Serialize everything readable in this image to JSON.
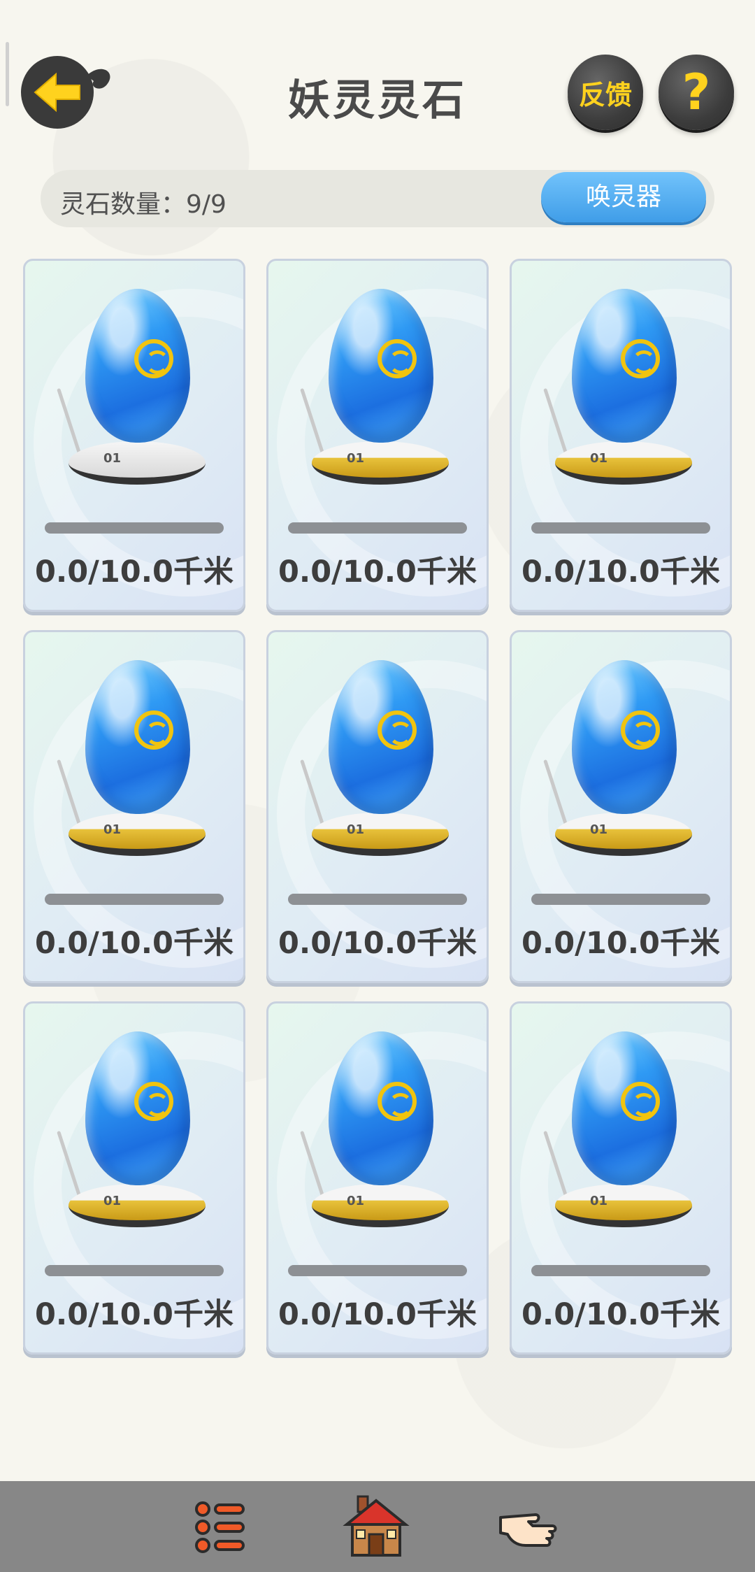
{
  "header": {
    "title": "妖灵灵石",
    "feedback_label": "反馈",
    "help_label": "?"
  },
  "count": {
    "label": "灵石数量：9/9",
    "summon_label": "唤灵器"
  },
  "stones": [
    {
      "progress": 0.0,
      "distance": "0.0/10.0千米",
      "base_label": "01",
      "base_color": "silver"
    },
    {
      "progress": 0.0,
      "distance": "0.0/10.0千米",
      "base_label": "01",
      "base_color": "gold"
    },
    {
      "progress": 0.0,
      "distance": "0.0/10.0千米",
      "base_label": "01",
      "base_color": "gold"
    },
    {
      "progress": 0.0,
      "distance": "0.0/10.0千米",
      "base_label": "01",
      "base_color": "gold"
    },
    {
      "progress": 0.0,
      "distance": "0.0/10.0千米",
      "base_label": "01",
      "base_color": "gold"
    },
    {
      "progress": 0.0,
      "distance": "0.0/10.0千米",
      "base_label": "01",
      "base_color": "gold"
    },
    {
      "progress": 0.0,
      "distance": "0.0/10.0千米",
      "base_label": "01",
      "base_color": "gold"
    },
    {
      "progress": 0.0,
      "distance": "0.0/10.0千米",
      "base_label": "01",
      "base_color": "gold"
    },
    {
      "progress": 0.0,
      "distance": "0.0/10.0千米",
      "base_label": "01",
      "base_color": "gold"
    }
  ],
  "bottom_nav": [
    {
      "icon": "list-icon"
    },
    {
      "icon": "house-icon"
    },
    {
      "icon": "pointing-hand-icon"
    }
  ],
  "colors": {
    "accent_blue": "#3f9de8",
    "icon_yellow": "#ffd21e",
    "dark_button": "#3c3c3c"
  }
}
